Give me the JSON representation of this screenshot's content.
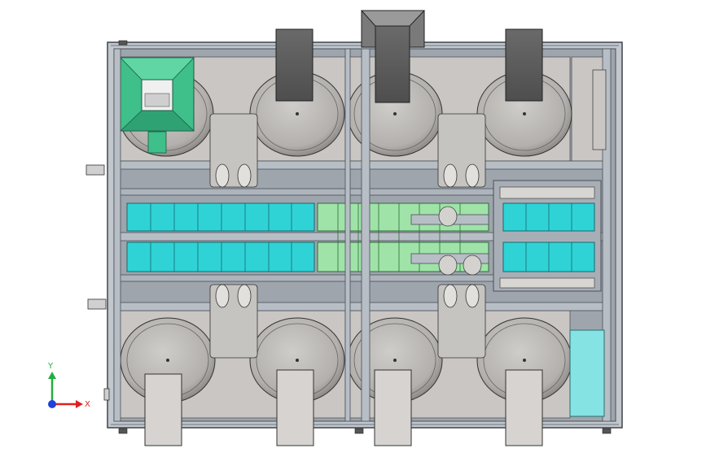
{
  "view": {
    "background": "#ffffff",
    "colors": {
      "frame": "#b8bec6",
      "frame_edge": "#4a4f57",
      "plate": "#c9c6c3",
      "bowl": "#bcb9b6",
      "hopper_dark": "#5f5f5f",
      "hopper_light": "#d6d3d0",
      "cyan_tray": "#2fd3d6",
      "green_tray": "#9fe3a8",
      "green_hopper": "#3fbf8a",
      "right_box": "#86e3e3",
      "axis_x": "#e02020",
      "axis_y": "#20b040",
      "axis_z": "#2040e0"
    }
  },
  "triad": {
    "x_label": "X",
    "y_label": "Y"
  }
}
